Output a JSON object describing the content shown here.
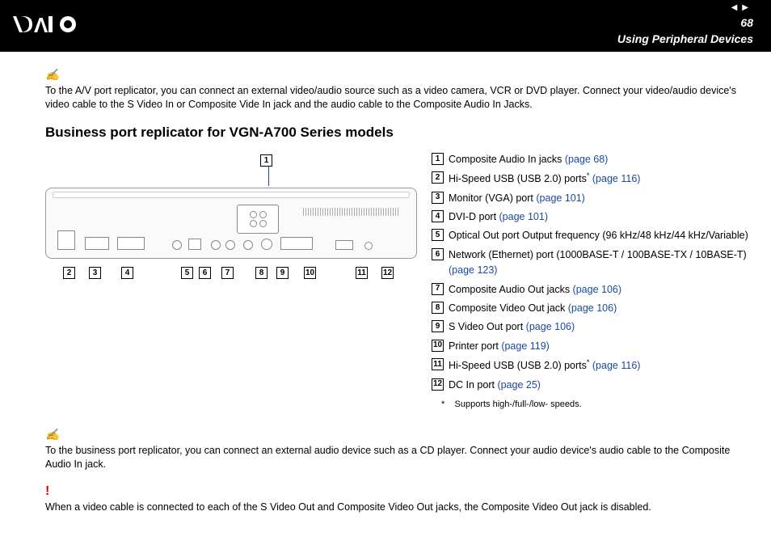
{
  "header": {
    "page_number": "68",
    "chapter": "Using Peripheral Devices",
    "nav_prev": "◀",
    "nav_next": "▶"
  },
  "note1": {
    "icon": "✍",
    "text": "To the A/V port replicator, you can connect an external video/audio source such as a video camera, VCR or DVD player. Connect your video/audio device's video cable to the S Video In or Composite Vide In jack and the audio cable to the Composite Audio In Jacks."
  },
  "section_title": "Business port replicator for VGN-A700 Series models",
  "diagram": {
    "callout_1": "1",
    "bottom_callouts": [
      "2",
      "3",
      "4",
      "5",
      "6",
      "7",
      "8",
      "9",
      "10",
      "11",
      "12"
    ]
  },
  "legend": [
    {
      "num": "1",
      "text": "Composite Audio In jacks ",
      "link": "(page 68)"
    },
    {
      "num": "2",
      "text": "Hi-Speed USB (USB 2.0) ports",
      "sup": "*",
      "link": " (page 116)"
    },
    {
      "num": "3",
      "text": "Monitor (VGA) port ",
      "link": "(page 101)"
    },
    {
      "num": "4",
      "text": "DVI-D port ",
      "link": "(page 101)"
    },
    {
      "num": "5",
      "text": "Optical Out port Output frequency (96 kHz/48 kHz/44 kHz/Variable)"
    },
    {
      "num": "6",
      "text": "Network (Ethernet) port (1000BASE-T / 100BASE-TX / 10BASE-T) ",
      "link": "(page 123)"
    },
    {
      "num": "7",
      "text": "Composite Audio Out jacks ",
      "link": "(page 106)"
    },
    {
      "num": "8",
      "text": "Composite Video Out jack ",
      "link": "(page 106)"
    },
    {
      "num": "9",
      "text": "S Video Out port ",
      "link": "(page 106)"
    },
    {
      "num": "10",
      "text": "Printer port ",
      "link": "(page 119)"
    },
    {
      "num": "11",
      "text": "Hi-Speed USB (USB 2.0) ports",
      "sup": "*",
      "link": " (page 116)"
    },
    {
      "num": "12",
      "text": "DC In port ",
      "link": "(page 25)"
    }
  ],
  "footnote": {
    "mark": "*",
    "text": "Supports high-/full-/low- speeds."
  },
  "note2": {
    "icon": "✍",
    "text": "To the business port replicator, you can connect an external audio device such as a CD player. Connect your audio device's audio cable to the Composite Audio In jack."
  },
  "warning": {
    "icon": "!",
    "text": "When a video cable is connected to each of the S Video Out and Composite Video Out jacks, the Composite Video Out jack is disabled."
  }
}
